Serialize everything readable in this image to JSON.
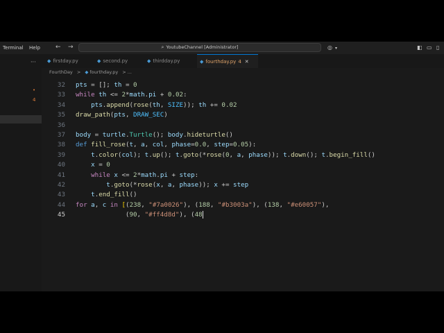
{
  "titlebar": {
    "menu": [
      "Terminal",
      "Help"
    ],
    "search_text": "YoutubeChannel [Administrator]"
  },
  "tabs": [
    {
      "label": "firstday.py",
      "active": false
    },
    {
      "label": "second.py",
      "active": false
    },
    {
      "label": "thirdday.py",
      "active": false
    },
    {
      "label": "fourthday.py",
      "active": true,
      "badge": "4"
    }
  ],
  "breadcrumb": {
    "folder": "FourthDay",
    "sep": ">",
    "file": "fourthday.py",
    "more": "> ..."
  },
  "gutter_markers": [
    "4"
  ],
  "editor": {
    "current_line": 45,
    "lines": [
      {
        "n": "32",
        "tokens": [
          [
            "var",
            "pts"
          ],
          [
            "p",
            " = []; "
          ],
          [
            "var",
            "th"
          ],
          [
            "p",
            " = "
          ],
          [
            "num",
            "0"
          ]
        ]
      },
      {
        "n": "33",
        "tokens": [
          [
            "kw",
            "while"
          ],
          [
            "p",
            " "
          ],
          [
            "var",
            "th"
          ],
          [
            "p",
            " <= "
          ],
          [
            "num",
            "2"
          ],
          [
            "p",
            "*"
          ],
          [
            "var",
            "math"
          ],
          [
            "p",
            "."
          ],
          [
            "var",
            "pi"
          ],
          [
            "p",
            " + "
          ],
          [
            "num",
            "0.02"
          ],
          [
            "p",
            ":"
          ]
        ]
      },
      {
        "n": "34",
        "tokens": [
          [
            "p",
            "    "
          ],
          [
            "var",
            "pts"
          ],
          [
            "p",
            "."
          ],
          [
            "fn",
            "append"
          ],
          [
            "p",
            "("
          ],
          [
            "fn",
            "rose"
          ],
          [
            "p",
            "("
          ],
          [
            "var",
            "th"
          ],
          [
            "p",
            ", "
          ],
          [
            "const",
            "SIZE"
          ],
          [
            "p",
            "));"
          ],
          [
            "p",
            " "
          ],
          [
            "var",
            "th"
          ],
          [
            "p",
            " += "
          ],
          [
            "num",
            "0.02"
          ]
        ]
      },
      {
        "n": "35",
        "tokens": [
          [
            "fn",
            "draw_path"
          ],
          [
            "p",
            "("
          ],
          [
            "var",
            "pts"
          ],
          [
            "p",
            ", "
          ],
          [
            "const",
            "DRAW_SEC"
          ],
          [
            "p",
            ")"
          ]
        ]
      },
      {
        "n": "36",
        "tokens": []
      },
      {
        "n": "37",
        "tokens": [
          [
            "var",
            "body"
          ],
          [
            "p",
            " = "
          ],
          [
            "var",
            "turtle"
          ],
          [
            "p",
            "."
          ],
          [
            "cls",
            "Turtle"
          ],
          [
            "p",
            "(); "
          ],
          [
            "var",
            "body"
          ],
          [
            "p",
            "."
          ],
          [
            "fn",
            "hideturtle"
          ],
          [
            "p",
            "()"
          ]
        ]
      },
      {
        "n": "38",
        "tokens": [
          [
            "kw2",
            "def"
          ],
          [
            "p",
            " "
          ],
          [
            "fn",
            "fill_rose"
          ],
          [
            "p",
            "("
          ],
          [
            "var",
            "t"
          ],
          [
            "p",
            ", "
          ],
          [
            "var",
            "a"
          ],
          [
            "p",
            ", "
          ],
          [
            "var",
            "col"
          ],
          [
            "p",
            ", "
          ],
          [
            "var",
            "phase"
          ],
          [
            "p",
            "="
          ],
          [
            "num",
            "0.0"
          ],
          [
            "p",
            ", "
          ],
          [
            "var",
            "step"
          ],
          [
            "p",
            "="
          ],
          [
            "num",
            "0.05"
          ],
          [
            "p",
            "):"
          ]
        ]
      },
      {
        "n": "39",
        "tokens": [
          [
            "p",
            "    "
          ],
          [
            "var",
            "t"
          ],
          [
            "p",
            "."
          ],
          [
            "fn",
            "color"
          ],
          [
            "p",
            "("
          ],
          [
            "var",
            "col"
          ],
          [
            "p",
            "); "
          ],
          [
            "var",
            "t"
          ],
          [
            "p",
            "."
          ],
          [
            "fn",
            "up"
          ],
          [
            "p",
            "(); "
          ],
          [
            "var",
            "t"
          ],
          [
            "p",
            "."
          ],
          [
            "fn",
            "goto"
          ],
          [
            "p",
            "(*"
          ],
          [
            "fn",
            "rose"
          ],
          [
            "p",
            "("
          ],
          [
            "num",
            "0"
          ],
          [
            "p",
            ", "
          ],
          [
            "var",
            "a"
          ],
          [
            "p",
            ", "
          ],
          [
            "var",
            "phase"
          ],
          [
            "p",
            "));"
          ],
          [
            "p",
            " "
          ],
          [
            "var",
            "t"
          ],
          [
            "p",
            "."
          ],
          [
            "fn",
            "down"
          ],
          [
            "p",
            "(); "
          ],
          [
            "var",
            "t"
          ],
          [
            "p",
            "."
          ],
          [
            "fn",
            "begin_fill"
          ],
          [
            "p",
            "()"
          ]
        ]
      },
      {
        "n": "40",
        "tokens": [
          [
            "p",
            "    "
          ],
          [
            "var",
            "x"
          ],
          [
            "p",
            " = "
          ],
          [
            "num",
            "0"
          ]
        ]
      },
      {
        "n": "41",
        "tokens": [
          [
            "p",
            "    "
          ],
          [
            "kw",
            "while"
          ],
          [
            "p",
            " "
          ],
          [
            "var",
            "x"
          ],
          [
            "p",
            " <= "
          ],
          [
            "num",
            "2"
          ],
          [
            "p",
            "*"
          ],
          [
            "var",
            "math"
          ],
          [
            "p",
            "."
          ],
          [
            "var",
            "pi"
          ],
          [
            "p",
            " + "
          ],
          [
            "var",
            "step"
          ],
          [
            "p",
            ":"
          ]
        ]
      },
      {
        "n": "42",
        "tokens": [
          [
            "p",
            "        "
          ],
          [
            "var",
            "t"
          ],
          [
            "p",
            "."
          ],
          [
            "fn",
            "goto"
          ],
          [
            "p",
            "(*"
          ],
          [
            "fn",
            "rose"
          ],
          [
            "p",
            "("
          ],
          [
            "var",
            "x"
          ],
          [
            "p",
            ", "
          ],
          [
            "var",
            "a"
          ],
          [
            "p",
            ", "
          ],
          [
            "var",
            "phase"
          ],
          [
            "p",
            "));"
          ],
          [
            "p",
            " "
          ],
          [
            "var",
            "x"
          ],
          [
            "p",
            " += "
          ],
          [
            "var",
            "step"
          ]
        ]
      },
      {
        "n": "43",
        "tokens": [
          [
            "p",
            "    "
          ],
          [
            "var",
            "t"
          ],
          [
            "p",
            "."
          ],
          [
            "fn",
            "end_fill"
          ],
          [
            "p",
            "()"
          ]
        ]
      },
      {
        "n": "44",
        "tokens": [
          [
            "kw",
            "for"
          ],
          [
            "p",
            " "
          ],
          [
            "var",
            "a"
          ],
          [
            "p",
            ", "
          ],
          [
            "var",
            "c"
          ],
          [
            "p",
            " "
          ],
          [
            "kw",
            "in"
          ],
          [
            "p",
            " "
          ],
          [
            "brk",
            "["
          ],
          [
            "p",
            "("
          ],
          [
            "num",
            "238"
          ],
          [
            "p",
            ", "
          ],
          [
            "str",
            "\"#7a0026\""
          ],
          [
            "p",
            "), ("
          ],
          [
            "num",
            "188"
          ],
          [
            "p",
            ", "
          ],
          [
            "str",
            "\"#b3003a\""
          ],
          [
            "p",
            "), ("
          ],
          [
            "num",
            "138"
          ],
          [
            "p",
            ", "
          ],
          [
            "str",
            "\"#e60057\""
          ],
          [
            "p",
            "),"
          ]
        ]
      },
      {
        "n": "45",
        "tokens": [
          [
            "p",
            "             "
          ],
          [
            "p",
            "("
          ],
          [
            "num",
            "90"
          ],
          [
            "p",
            ", "
          ],
          [
            "str",
            "\"#ff4d8d\""
          ],
          [
            "p",
            "), ("
          ],
          [
            "num",
            "48"
          ]
        ]
      }
    ]
  }
}
